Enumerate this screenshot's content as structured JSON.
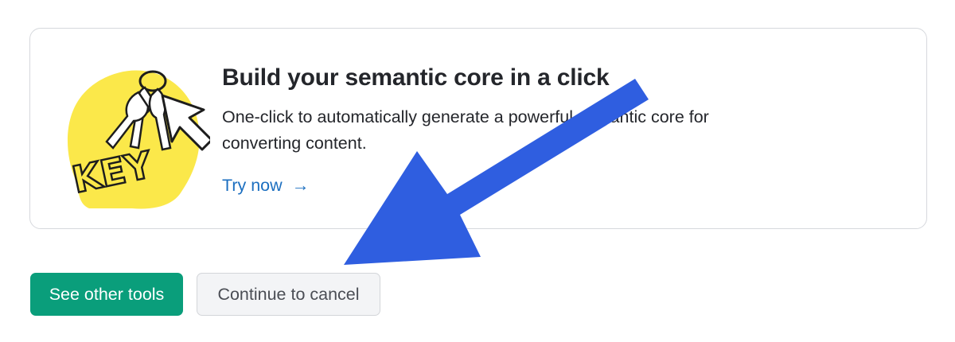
{
  "promo": {
    "title": "Build your semantic core in a click",
    "description": "One-click to automatically generate a powerful semantic core for converting content.",
    "link_label": "Try now",
    "link_arrow": "→",
    "illustration_text": "KEY"
  },
  "actions": {
    "primary_label": "See other tools",
    "secondary_label": "Continue to cancel"
  },
  "colors": {
    "primary_button": "#0a9e7b",
    "link": "#1c6fc0",
    "annotation_arrow": "#2f5ee0",
    "illustration_blob": "#fbe84a"
  },
  "annotation": {
    "icon": "arrow-pointing-down-left-icon"
  }
}
